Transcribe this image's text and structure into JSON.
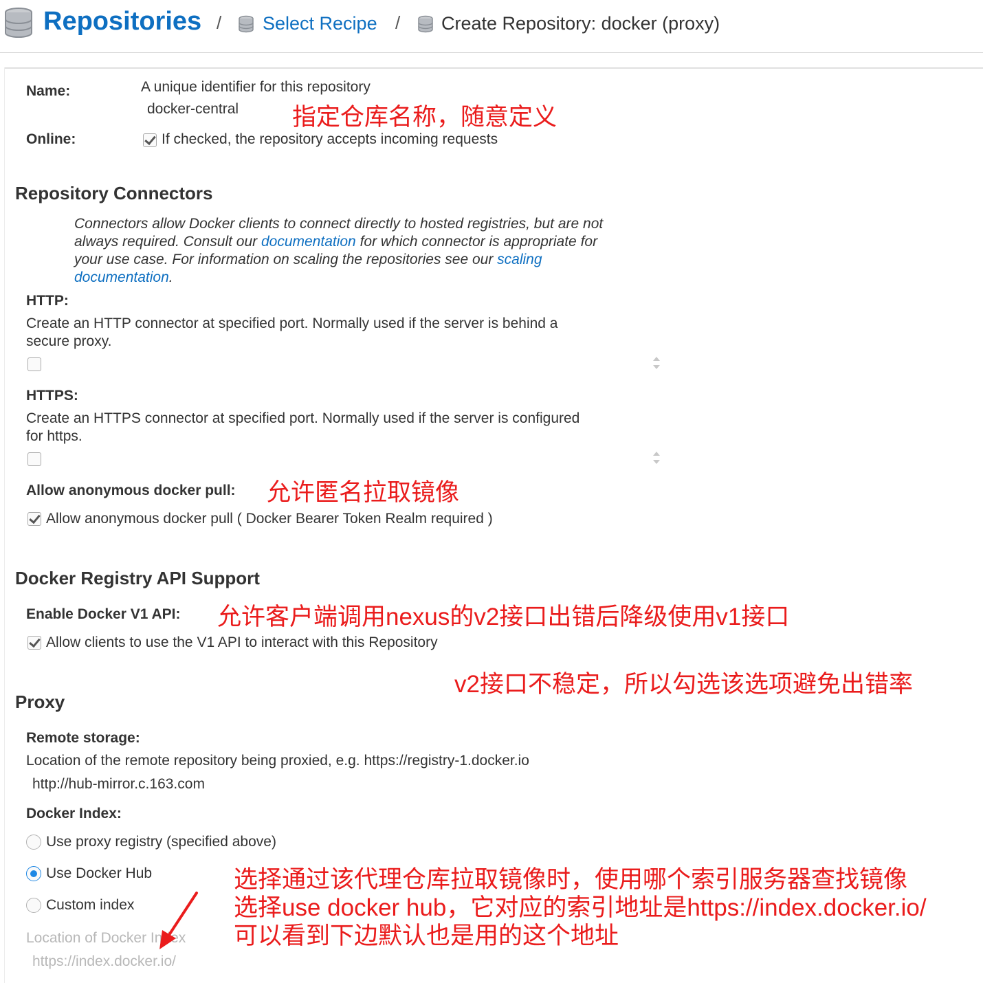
{
  "breadcrumb": {
    "title": "Repositories",
    "separator": "/",
    "select_recipe": "Select Recipe",
    "current": "Create Repository: docker (proxy)"
  },
  "name_field": {
    "label": "Name:",
    "help": "A unique identifier for this repository",
    "value": "docker-central"
  },
  "online_field": {
    "label": "Online:",
    "checked": true,
    "help": "If checked, the repository accepts incoming requests"
  },
  "connectors": {
    "heading": "Repository Connectors",
    "intro_1": "Connectors allow Docker clients to connect directly to hosted registries, but are not always required. Consult our ",
    "intro_link_1": "documentation",
    "intro_2": " for which connector is appropriate for your use case. For information on scaling the repositories see our ",
    "intro_link_2": "scaling documentation",
    "intro_3": ".",
    "http": {
      "label": "HTTP:",
      "help_line1": "Create an HTTP connector at specified port. Normally used if the server is behind a",
      "help_line2": "secure proxy.",
      "checked": false
    },
    "https": {
      "label": "HTTPS:",
      "help_line1": "Create an HTTPS connector at specified port. Normally used if the server is configured",
      "help_line2": "for https.",
      "checked": false
    },
    "anonymous": {
      "label": "Allow anonymous docker pull:",
      "checked": true,
      "help": "Allow anonymous docker pull ( Docker Bearer Token Realm required )"
    }
  },
  "api_support": {
    "heading": "Docker Registry API Support",
    "v1_label": "Enable Docker V1 API:",
    "v1_checked": true,
    "v1_help": "Allow clients to use the V1 API to interact with this Repository"
  },
  "proxy": {
    "heading": "Proxy",
    "remote_label": "Remote storage:",
    "remote_help": "Location of the remote repository being proxied, e.g. https://registry-1.docker.io",
    "remote_value": "http://hub-mirror.c.163.com",
    "index_label": "Docker Index:",
    "options": [
      {
        "label": "Use proxy registry (specified above)",
        "selected": false
      },
      {
        "label": "Use Docker Hub",
        "selected": true
      },
      {
        "label": "Custom index",
        "selected": false
      }
    ],
    "location_label": "Location of Docker Index",
    "location_value": "https://index.docker.io/"
  },
  "annotations": {
    "name": "指定仓库名称，随意定义",
    "anonymous": "允许匿名拉取镜像",
    "v1": "允许客户端调用nexus的v2接口出错后降级使用v1接口",
    "v2_unstable": "v2接口不稳定，所以勾选该选项避免出错率",
    "index_line1": "选择通过该代理仓库拉取镜像时，使用哪个索引服务器查找镜像",
    "index_line2": "选择use docker hub，它对应的索引地址是https://index.docker.io/",
    "index_line3": "可以看到下边默认也是用的这个地址"
  },
  "colors": {
    "link": "#0e6fc1",
    "annotation": "#ea1c1c",
    "radio_selected": "#1e88e5"
  }
}
